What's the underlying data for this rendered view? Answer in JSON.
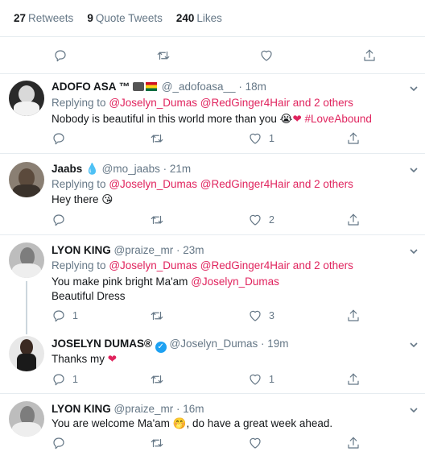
{
  "stats": {
    "retweets_count": "27",
    "retweets_label": "Retweets",
    "quotes_count": "9",
    "quotes_label": "Quote Tweets",
    "likes_count": "240",
    "likes_label": "Likes"
  },
  "replies": [
    {
      "name": "ADOFO ASA ™",
      "handle": "@_adofoasa__",
      "time": "· 18m",
      "replying_prefix": "Replying to",
      "replying_to": "@Joselyn_Dumas @RedGinger4Hair and 2 others",
      "text": "Nobody is beautiful in this world more than you",
      "hashtag": "#LoveAbound",
      "reply_count": "",
      "retweet_count": "",
      "like_count": "1"
    },
    {
      "name": "Jaabs",
      "handle": "@mo_jaabs",
      "time": "· 21m",
      "replying_prefix": "Replying to",
      "replying_to": "@Joselyn_Dumas @RedGinger4Hair and 2 others",
      "text": "Hey there",
      "reply_count": "",
      "retweet_count": "",
      "like_count": "2"
    },
    {
      "name": "LYON KING",
      "handle": "@praize_mr",
      "time": "· 23m",
      "replying_prefix": "Replying to",
      "replying_to": "@Joselyn_Dumas @RedGinger4Hair and 2 others",
      "text": "You make pink bright Ma'am",
      "mention": "@Joselyn_Dumas",
      "text2": "Beautiful Dress",
      "reply_count": "1",
      "retweet_count": "",
      "like_count": "3"
    },
    {
      "name": "JOSELYN DUMAS®",
      "handle": "@Joselyn_Dumas",
      "time": "· 19m",
      "text": "Thanks my",
      "reply_count": "1",
      "retweet_count": "",
      "like_count": "1"
    },
    {
      "name": "LYON KING",
      "handle": "@praize_mr",
      "time": "· 16m",
      "text": "You are welcome Ma'am",
      "text_after": ", do have a great week ahead.",
      "reply_count": "",
      "retweet_count": "",
      "like_count": ""
    }
  ],
  "colors": {
    "link": "#e0245e",
    "secondary": "#657786",
    "border": "#e6ecf0",
    "verified": "#1da1f2"
  },
  "icons": [
    "reply-icon",
    "retweet-icon",
    "like-icon",
    "share-icon",
    "chevron-down-icon",
    "verified-badge-icon"
  ]
}
